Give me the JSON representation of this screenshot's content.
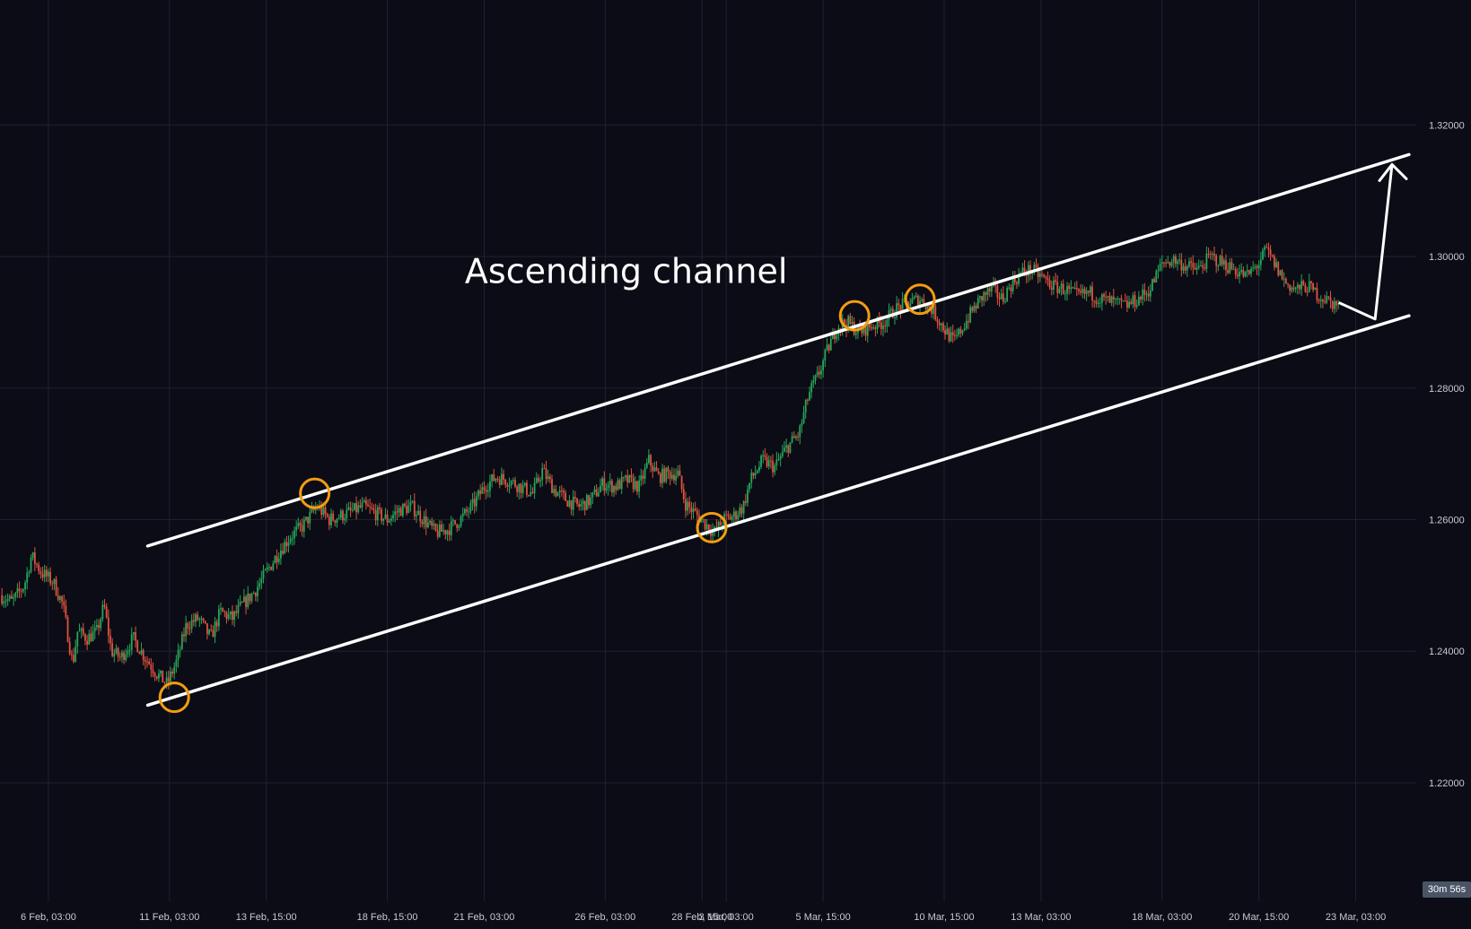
{
  "chart_data": {
    "type": "candlestick",
    "title": "",
    "xlabel": "",
    "ylabel": "",
    "ylim": [
      1.202,
      1.339
    ],
    "grid": true,
    "colors": {
      "background": "#0b0c15",
      "grid": "#1e2230",
      "up": "#26a65b",
      "down": "#e0523f",
      "channel": "#ffffff",
      "touch_marker": "#f39c12"
    },
    "y_ticks": [
      {
        "value": 1.32,
        "label": "1.32000"
      },
      {
        "value": 1.3,
        "label": "1.30000"
      },
      {
        "value": 1.28,
        "label": "1.28000"
      },
      {
        "value": 1.26,
        "label": "1.26000"
      },
      {
        "value": 1.24,
        "label": "1.24000"
      },
      {
        "value": 1.22,
        "label": "1.22000"
      }
    ],
    "x_ticks": [
      {
        "t": 1,
        "label": "6 Feb, 03:00"
      },
      {
        "t": 6,
        "label": "11 Feb, 03:00"
      },
      {
        "t": 10,
        "label": "13 Feb, 15:00"
      },
      {
        "t": 15,
        "label": "18 Feb, 15:00"
      },
      {
        "t": 19,
        "label": "21 Feb, 03:00"
      },
      {
        "t": 24,
        "label": "26 Feb, 03:00"
      },
      {
        "t": 28,
        "label": "28 Feb, 15:00"
      },
      {
        "t": 29,
        "label": "3 Mar, 03:00"
      },
      {
        "t": 33,
        "label": "5 Mar, 15:00"
      },
      {
        "t": 38,
        "label": "10 Mar, 15:00"
      },
      {
        "t": 42,
        "label": "13 Mar, 03:00"
      },
      {
        "t": 47,
        "label": "18 Mar, 03:00"
      },
      {
        "t": 51,
        "label": "20 Mar, 15:00"
      },
      {
        "t": 55,
        "label": "23 Mar, 03:00"
      }
    ],
    "x_range": [
      -1,
      57.5
    ],
    "price_path": [
      [
        -1.0,
        1.2485
      ],
      [
        -0.5,
        1.2475
      ],
      [
        0.0,
        1.25
      ],
      [
        0.3,
        1.2545
      ],
      [
        0.7,
        1.252
      ],
      [
        1.2,
        1.2505
      ],
      [
        1.6,
        1.247
      ],
      [
        2.0,
        1.238
      ],
      [
        2.2,
        1.243
      ],
      [
        2.6,
        1.242
      ],
      [
        3.0,
        1.243
      ],
      [
        3.3,
        1.247
      ],
      [
        3.6,
        1.24
      ],
      [
        4.0,
        1.239
      ],
      [
        4.5,
        1.242
      ],
      [
        5.0,
        1.239
      ],
      [
        5.5,
        1.2365
      ],
      [
        5.9,
        1.235
      ],
      [
        6.3,
        1.2385
      ],
      [
        6.7,
        1.244
      ],
      [
        7.2,
        1.245
      ],
      [
        7.7,
        1.242
      ],
      [
        8.1,
        1.246
      ],
      [
        8.6,
        1.245
      ],
      [
        9.0,
        1.247
      ],
      [
        9.5,
        1.249
      ],
      [
        10.0,
        1.252
      ],
      [
        10.5,
        1.255
      ],
      [
        11.0,
        1.2575
      ],
      [
        11.5,
        1.259
      ],
      [
        12.1,
        1.262
      ],
      [
        12.6,
        1.26
      ],
      [
        13.0,
        1.2605
      ],
      [
        13.5,
        1.2612
      ],
      [
        14.0,
        1.262
      ],
      [
        14.5,
        1.261
      ],
      [
        15.0,
        1.26
      ],
      [
        15.5,
        1.2615
      ],
      [
        16.0,
        1.262
      ],
      [
        16.5,
        1.26
      ],
      [
        17.0,
        1.258
      ],
      [
        17.5,
        1.2585
      ],
      [
        18.0,
        1.26
      ],
      [
        18.5,
        1.262
      ],
      [
        19.0,
        1.265
      ],
      [
        19.5,
        1.2665
      ],
      [
        20.0,
        1.266
      ],
      [
        20.5,
        1.265
      ],
      [
        21.0,
        1.264
      ],
      [
        21.4,
        1.2675
      ],
      [
        21.9,
        1.2645
      ],
      [
        22.4,
        1.263
      ],
      [
        22.9,
        1.262
      ],
      [
        23.4,
        1.263
      ],
      [
        23.9,
        1.2655
      ],
      [
        24.4,
        1.265
      ],
      [
        24.9,
        1.266
      ],
      [
        25.4,
        1.265
      ],
      [
        25.8,
        1.269
      ],
      [
        26.2,
        1.2665
      ],
      [
        26.6,
        1.267
      ],
      [
        27.0,
        1.267
      ],
      [
        27.3,
        1.2625
      ],
      [
        27.7,
        1.261
      ],
      [
        28.1,
        1.2595
      ],
      [
        28.5,
        1.258
      ],
      [
        28.9,
        1.26
      ],
      [
        29.3,
        1.2605
      ],
      [
        29.7,
        1.262
      ],
      [
        30.0,
        1.266
      ],
      [
        30.5,
        1.269
      ],
      [
        31.0,
        1.268
      ],
      [
        31.5,
        1.271
      ],
      [
        32.0,
        1.273
      ],
      [
        32.4,
        1.279
      ],
      [
        32.8,
        1.282
      ],
      [
        33.2,
        1.286
      ],
      [
        33.6,
        1.2895
      ],
      [
        34.0,
        1.29
      ],
      [
        34.5,
        1.2885
      ],
      [
        35.0,
        1.2895
      ],
      [
        35.5,
        1.29
      ],
      [
        36.0,
        1.292
      ],
      [
        36.5,
        1.293
      ],
      [
        37.0,
        1.2935
      ],
      [
        37.5,
        1.292
      ],
      [
        38.0,
        1.289
      ],
      [
        38.4,
        1.287
      ],
      [
        38.8,
        1.2895
      ],
      [
        39.2,
        1.292
      ],
      [
        39.6,
        1.294
      ],
      [
        40.0,
        1.295
      ],
      [
        40.4,
        1.2935
      ],
      [
        40.8,
        1.296
      ],
      [
        41.2,
        1.2975
      ],
      [
        41.6,
        1.298
      ],
      [
        42.0,
        1.297
      ],
      [
        42.5,
        1.2955
      ],
      [
        43.0,
        1.295
      ],
      [
        43.5,
        1.294
      ],
      [
        44.0,
        1.2945
      ],
      [
        44.5,
        1.2935
      ],
      [
        45.0,
        1.293
      ],
      [
        45.5,
        1.2925
      ],
      [
        46.0,
        1.2935
      ],
      [
        46.5,
        1.295
      ],
      [
        47.0,
        1.299
      ],
      [
        47.5,
        1.2995
      ],
      [
        48.0,
        1.2985
      ],
      [
        48.5,
        1.298
      ],
      [
        49.0,
        1.3
      ],
      [
        49.5,
        1.299
      ],
      [
        50.0,
        1.298
      ],
      [
        50.5,
        1.297
      ],
      [
        51.0,
        1.299
      ],
      [
        51.3,
        1.301
      ],
      [
        51.7,
        1.2985
      ],
      [
        52.1,
        1.296
      ],
      [
        52.5,
        1.295
      ],
      [
        53.0,
        1.2955
      ],
      [
        53.5,
        1.294
      ],
      [
        54.0,
        1.293
      ],
      [
        54.3,
        1.2925
      ]
    ],
    "channel": {
      "upper": [
        [
          5.1,
          1.256
        ],
        [
          57.2,
          1.3155
        ]
      ],
      "lower": [
        [
          5.1,
          1.2318
        ],
        [
          57.2,
          1.291
        ]
      ]
    },
    "touch_points": [
      {
        "t": 6.2,
        "y": 1.233
      },
      {
        "t": 12.0,
        "y": 1.264
      },
      {
        "t": 28.4,
        "y": 1.2588
      },
      {
        "t": 34.3,
        "y": 1.291
      },
      {
        "t": 37.0,
        "y": 1.2935
      }
    ],
    "projection": [
      [
        54.3,
        1.293
      ],
      [
        55.8,
        1.2905
      ],
      [
        56.5,
        1.314
      ]
    ],
    "annotations": [
      {
        "text": "Ascending channel",
        "t": 18.2,
        "y": 1.296
      }
    ],
    "countdown_label": "30m 56s"
  }
}
